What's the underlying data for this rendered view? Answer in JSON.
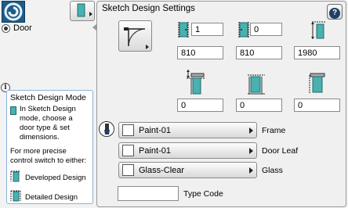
{
  "left": {
    "logo_icon": "spiral-logo-icon",
    "door_label": "Door"
  },
  "help": {
    "title": "Sketch Design Mode",
    "line1": "In Sketch Design mode, choose a door type & set dimensions.",
    "line2": "For more precise control switch to either:",
    "option1": "Developed Design",
    "option2": "Detailed Design"
  },
  "panel": {
    "title": "Sketch Design Settings",
    "help_button": "?"
  },
  "dimensions": {
    "leaf_count_left": "1",
    "leaf_count_right": "0",
    "width_1": "810",
    "width_2": "810",
    "height": "1980",
    "offset_1": "0",
    "offset_2": "0",
    "offset_3": "0"
  },
  "materials": [
    {
      "value": "Paint-01",
      "label": "Frame"
    },
    {
      "value": "Paint-01",
      "label": "Door Leaf"
    },
    {
      "value": "Glass-Clear",
      "label": "Glass"
    }
  ],
  "type_code": {
    "value": "",
    "label": "Type Code"
  },
  "colors": {
    "door_teal": "#4ab0b0",
    "logo_blue": "#1d5c8a",
    "help_border": "#8cb3d9"
  }
}
